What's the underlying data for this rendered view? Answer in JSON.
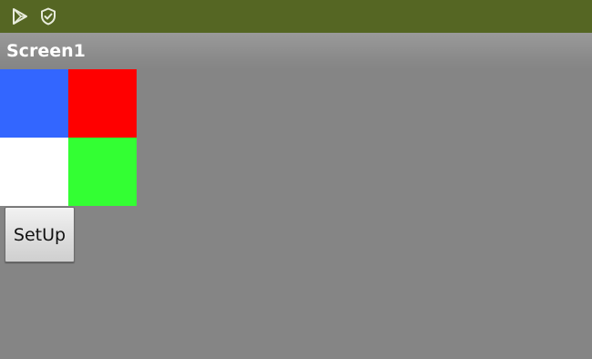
{
  "status_bar": {
    "background": "#556623",
    "icons": [
      "play-store-icon",
      "shield-check-icon"
    ]
  },
  "title_bar": {
    "title": "Screen1"
  },
  "grid": {
    "cells": [
      {
        "name": "blue",
        "color": "#3366ff"
      },
      {
        "name": "red",
        "color": "#ff0000"
      },
      {
        "name": "white",
        "color": "#ffffff"
      },
      {
        "name": "green",
        "color": "#33ff33"
      }
    ]
  },
  "main": {
    "background": "#858585",
    "setup_button_label": "SetUp"
  }
}
